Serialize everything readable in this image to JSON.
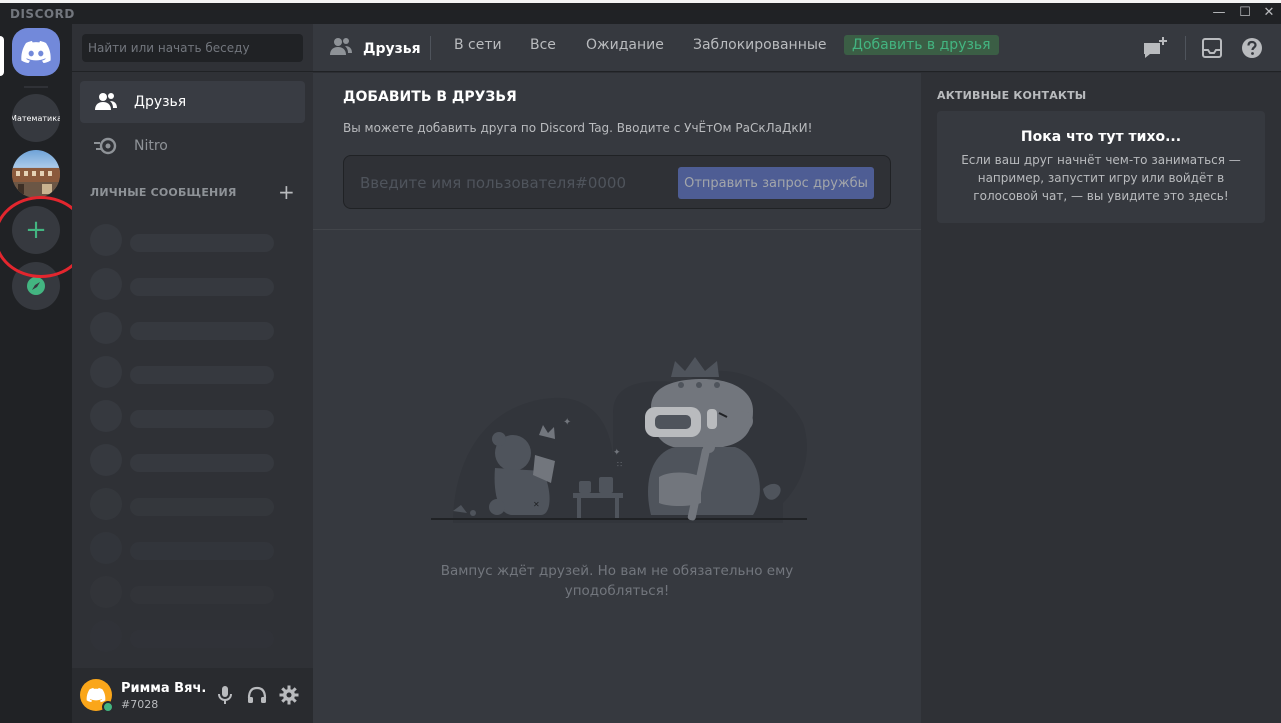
{
  "window": {
    "brand": "DISCORD",
    "minimize": "—",
    "maximize": "☐",
    "close": "✕"
  },
  "servers": {
    "math_label": "Математика",
    "add_glyph": "+"
  },
  "sidebar": {
    "search_placeholder": "Найти или начать беседу",
    "nav": [
      {
        "label": "Друзья",
        "icon": "friends-icon"
      },
      {
        "label": "Nitro",
        "icon": "nitro-icon"
      }
    ],
    "dm_header": "ЛИЧНЫЕ СООБЩЕНИЯ",
    "dm_add": "+"
  },
  "user": {
    "name": "Римма Вяч...",
    "tag": "#7028",
    "status_color": "#43b581"
  },
  "topbar": {
    "title": "Друзья",
    "tabs": [
      "В сети",
      "Все",
      "Ожидание",
      "Заблокированные"
    ],
    "add_friend": "Добавить в друзья"
  },
  "add_friend": {
    "title": "ДОБАВИТЬ В ДРУЗЬЯ",
    "description": "Вы можете добавить друга по Discord Tag. Вводите с УчЁтОм РаСкЛаДкИ!",
    "input_placeholder": "Введите имя пользователя#0000",
    "send_button": "Отправить запрос дружбы"
  },
  "empty_state": {
    "text": "Вампус ждёт друзей. Но вам не обязательно ему уподобляться!"
  },
  "active_contacts": {
    "title": "АКТИВНЫЕ КОНТАКТЫ",
    "card_title": "Пока что тут тихо...",
    "card_text": "Если ваш друг начнёт чем-то заниматься — например, запустит игру или войдёт в голосовой чат, — вы увидите это здесь!"
  },
  "colors": {
    "blurple": "#7289da",
    "green": "#43b581",
    "annotation_red": "#e3262e"
  }
}
